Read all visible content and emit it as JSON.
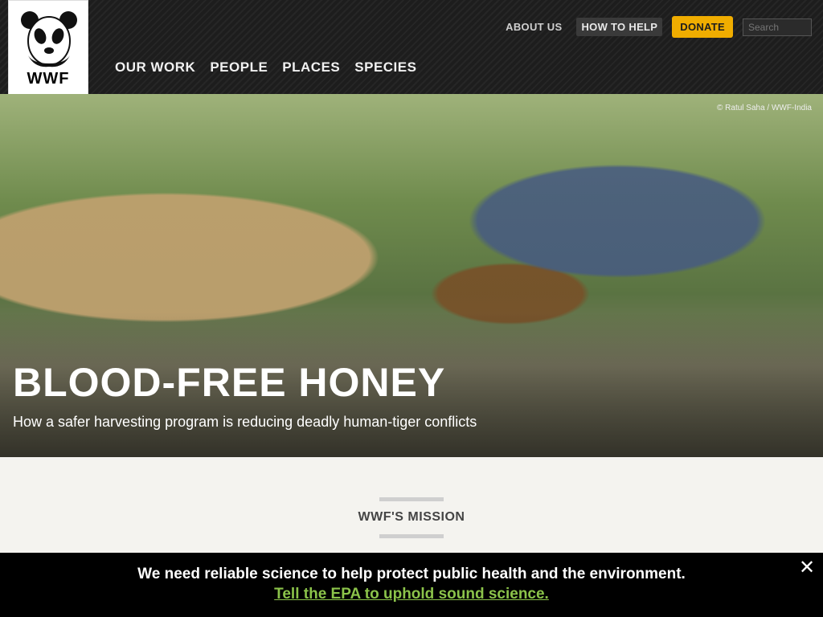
{
  "header": {
    "logo": {
      "text": "WWF"
    },
    "utility_nav": [
      {
        "label": "ABOUT US",
        "active": false
      },
      {
        "label": "HOW TO HELP",
        "active": true
      },
      {
        "label": "DONATE",
        "accent": "#f0ad00"
      }
    ],
    "search": {
      "placeholder": "Search"
    },
    "main_nav": [
      {
        "label": "OUR WORK"
      },
      {
        "label": "PEOPLE"
      },
      {
        "label": "PLACES"
      },
      {
        "label": "SPECIES"
      }
    ]
  },
  "hero": {
    "credit": "© Ratul Saha / WWF-India",
    "title": "Blood-Free Honey",
    "subtitle": "How a safer harvesting program is reducing deadly human-tiger conflicts"
  },
  "mission": {
    "label": "WWF's Mission"
  },
  "banner": {
    "message": "We need reliable science to help protect public health and the environment.",
    "cta": "Tell the EPA to uphold sound science.",
    "close_icon": "close-icon"
  }
}
